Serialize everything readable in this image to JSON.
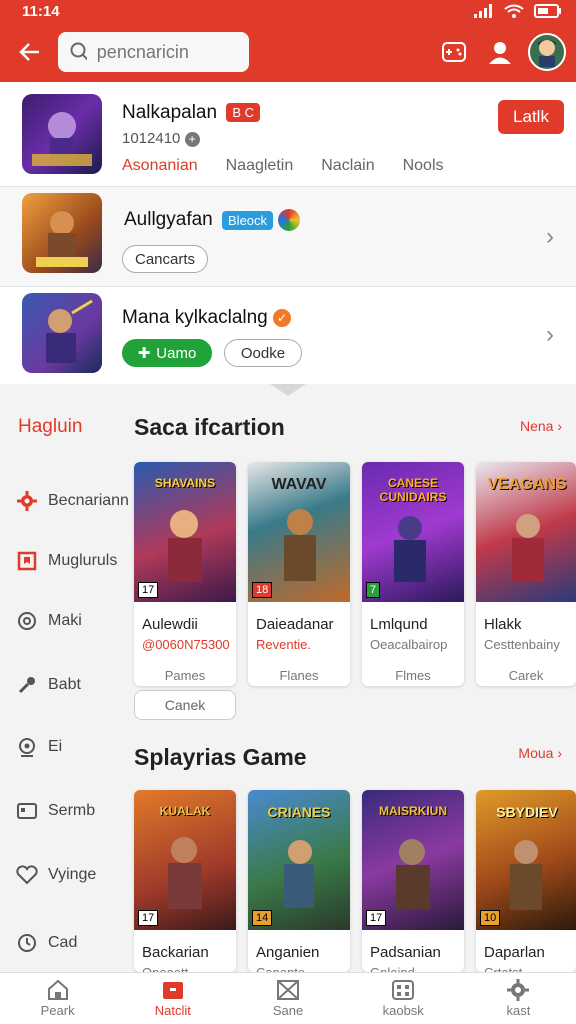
{
  "status": {
    "time": "11:14"
  },
  "toolbar": {
    "search_placeholder": "pencnaricin"
  },
  "top_list": [
    {
      "title": "Nalkapalan",
      "badge": "B C",
      "sub": "1012410",
      "button": "Latlk",
      "tabs": [
        "Asonanian",
        "Naagletin",
        "Naclain",
        "Nools"
      ]
    },
    {
      "title": "Aullgyafan",
      "badge": "Bleock",
      "pill": "Cancarts"
    },
    {
      "title": "Mana kylkaclalng",
      "pill_green": "Uamo",
      "pill": "Oodke"
    }
  ],
  "sidebar": {
    "heading": "Hagluin",
    "items": [
      "Becnariann",
      "Mugluruls",
      "Maki",
      "Babt",
      "Ei",
      "Sermb",
      "Vyinge",
      "Cad"
    ]
  },
  "section1": {
    "title": "Saca ifcartion",
    "more": "Nena",
    "cards": [
      {
        "art": "SHAVAINS",
        "title": "Aulewdii",
        "sub": "@0060N75300",
        "foot": "Pames",
        "rating": "17"
      },
      {
        "art": "WAVAV",
        "title": "Daieadanar",
        "sub": "Reventie.",
        "foot": "Flanes",
        "rating": "18"
      },
      {
        "art": "CANESE CUNIDAIRS",
        "title": "Lmlqund",
        "sub": "Oeacalbairop",
        "foot": "Flmes",
        "rating": "7"
      },
      {
        "art": "VEAGANS",
        "title": "Hlakk",
        "sub": "Cesttenbainy",
        "foot": "Carek",
        "rating": ""
      }
    ],
    "canek": "Canek"
  },
  "section2": {
    "title": "Splayrias Game",
    "more": "Moua",
    "cards": [
      {
        "art": "KUALAK",
        "title": "Backarian",
        "sub": "Onooott",
        "rating": "17"
      },
      {
        "art": "CRIANES",
        "title": "Anganien",
        "sub": "Canante",
        "rating": "14"
      },
      {
        "art": "MAISRKIUN",
        "title": "Padsanian",
        "sub": "Gnlaind",
        "rating": "17"
      },
      {
        "art": "SBYDIEV",
        "title": "Daparlan",
        "sub": "Crtatst",
        "rating": "10"
      }
    ]
  },
  "bottom_nav": [
    "Peark",
    "Natclit",
    "Sane",
    "kaobsk",
    "kast"
  ],
  "colors": {
    "accent": "#df3a2a",
    "green": "#22a33a"
  }
}
